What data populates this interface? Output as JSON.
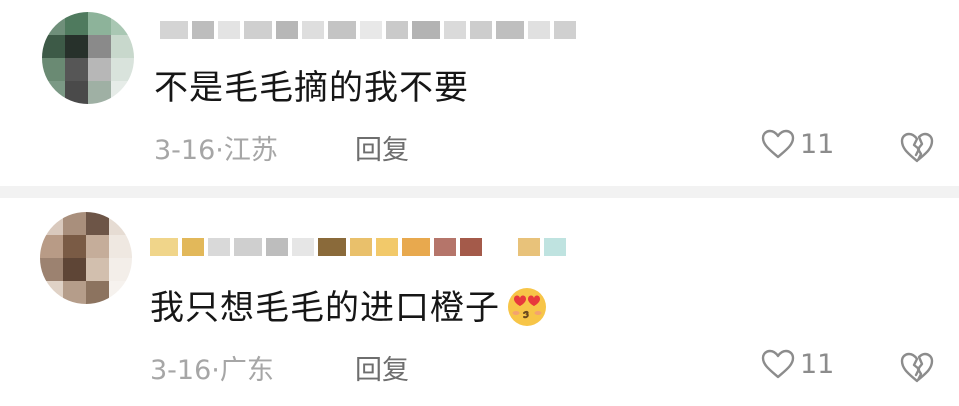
{
  "comments": [
    {
      "text": "不是毛毛摘的我不要",
      "date": "3-16·",
      "location": "江苏",
      "reply_label": "回复",
      "likes": "11",
      "avatar_colors": [
        "#6f8f7a",
        "#4f7a5e",
        "#8db39a",
        "#a9c7b3",
        "#3d5a47",
        "#27312b",
        "#8a8a8a",
        "#c8d8cc",
        "#6a8a73",
        "#565656",
        "#b7b7b7",
        "#d9e3dc",
        "#7b9985",
        "#4a4a4a",
        "#9fb0a4",
        "#e6ece8"
      ],
      "name_colors": [
        "#d4d4d4",
        "#bdbdbd",
        "#e3e3e3",
        "#cfcfcf",
        "#b7b7b7",
        "#dedede",
        "#c4c4c4",
        "#e8e8e8",
        "#cacaca",
        "#b3b3b3",
        "#dadada",
        "#cdcdcd",
        "#bfbfbf",
        "#e0e0e0",
        "#d0d0d0"
      ]
    },
    {
      "text": "我只想毛毛的进口橙子",
      "emoji": "heart-eyes-kiss-emoji",
      "date": "3-16·",
      "location": "广东",
      "reply_label": "回复",
      "likes": "11",
      "avatar_colors": [
        "#d9c9bd",
        "#a98f7c",
        "#6d5547",
        "#e6dcd3",
        "#b89b86",
        "#7a5b45",
        "#c5ad9a",
        "#efe8e1",
        "#9c8270",
        "#5e4536",
        "#d2bfae",
        "#f3eee9",
        "#e0d2c6",
        "#b59d8a",
        "#8c735f",
        "#f6f2ee"
      ],
      "name_colors": [
        "#f0d58a",
        "#e2b85a",
        "#d9d9d9",
        "#cfcfcf",
        "#bdbdbd",
        "#e6e6e6",
        "#8a6a3a",
        "#e9c06b",
        "#f2c96a",
        "#e8a94e",
        "#b5756a",
        "#a45a4a",
        "#ffffff",
        "#e8c27a",
        "#bfe3e0"
      ]
    }
  ]
}
